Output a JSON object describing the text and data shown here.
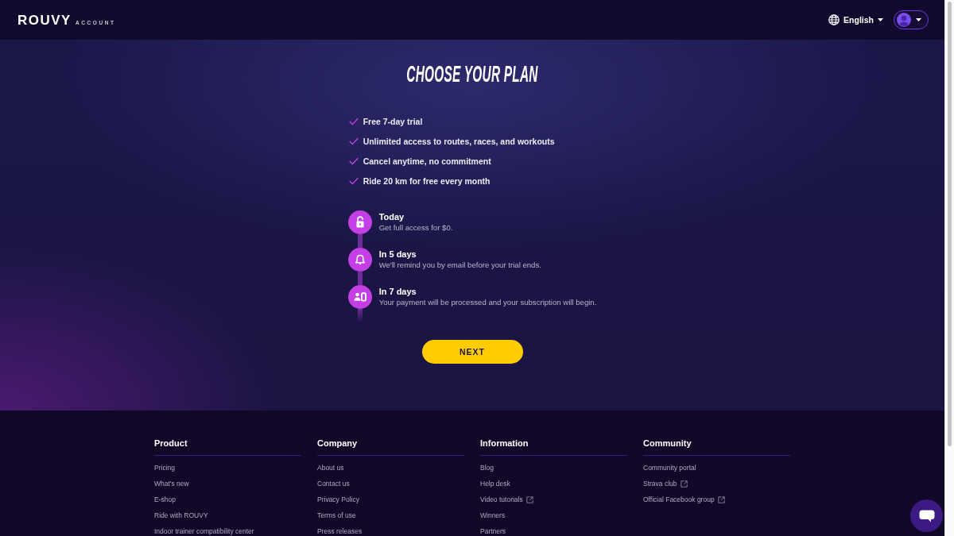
{
  "header": {
    "logo": {
      "brand": "ROUVY",
      "suffix": "ACCOUNT"
    },
    "language": "English"
  },
  "plan": {
    "title": "CHOOSE YOUR PLAN",
    "benefits": [
      "Free 7-day trial",
      "Unlimited access to routes, races, and workouts",
      "Cancel anytime, no commitment",
      "Ride 20 km for free every month"
    ],
    "timeline": [
      {
        "kind": "unlock",
        "title": "Today",
        "description": "Get full access for $0."
      },
      {
        "kind": "reminder",
        "title": "In 5 days",
        "description": "We'll remind you by email before your trial ends."
      },
      {
        "kind": "payment",
        "title": "In 7 days",
        "description": "Your payment will be processed and your subscription will begin."
      }
    ],
    "next_button": "NEXT"
  },
  "footer": {
    "columns": [
      {
        "title": "Product",
        "links": [
          {
            "label": "Pricing",
            "external": false
          },
          {
            "label": "What's new",
            "external": false
          },
          {
            "label": "E-shop",
            "external": false
          },
          {
            "label": "Ride with ROUVY",
            "external": false
          },
          {
            "label": "Indoor trainer compatibility center",
            "external": false
          }
        ]
      },
      {
        "title": "Company",
        "links": [
          {
            "label": "About us",
            "external": false
          },
          {
            "label": "Contact us",
            "external": false
          },
          {
            "label": "Privacy Policy",
            "external": false
          },
          {
            "label": "Terms of use",
            "external": false
          },
          {
            "label": "Press releases",
            "external": false
          }
        ]
      },
      {
        "title": "Information",
        "links": [
          {
            "label": "Blog",
            "external": false
          },
          {
            "label": "Help desk",
            "external": false
          },
          {
            "label": "Video tutorials",
            "external": true
          },
          {
            "label": "Winners",
            "external": false
          },
          {
            "label": "Partners",
            "external": false
          }
        ]
      },
      {
        "title": "Community",
        "links": [
          {
            "label": "Community portal",
            "external": false
          },
          {
            "label": "Strava club",
            "external": true
          },
          {
            "label": "Official Facebook group",
            "external": true
          }
        ]
      }
    ]
  }
}
